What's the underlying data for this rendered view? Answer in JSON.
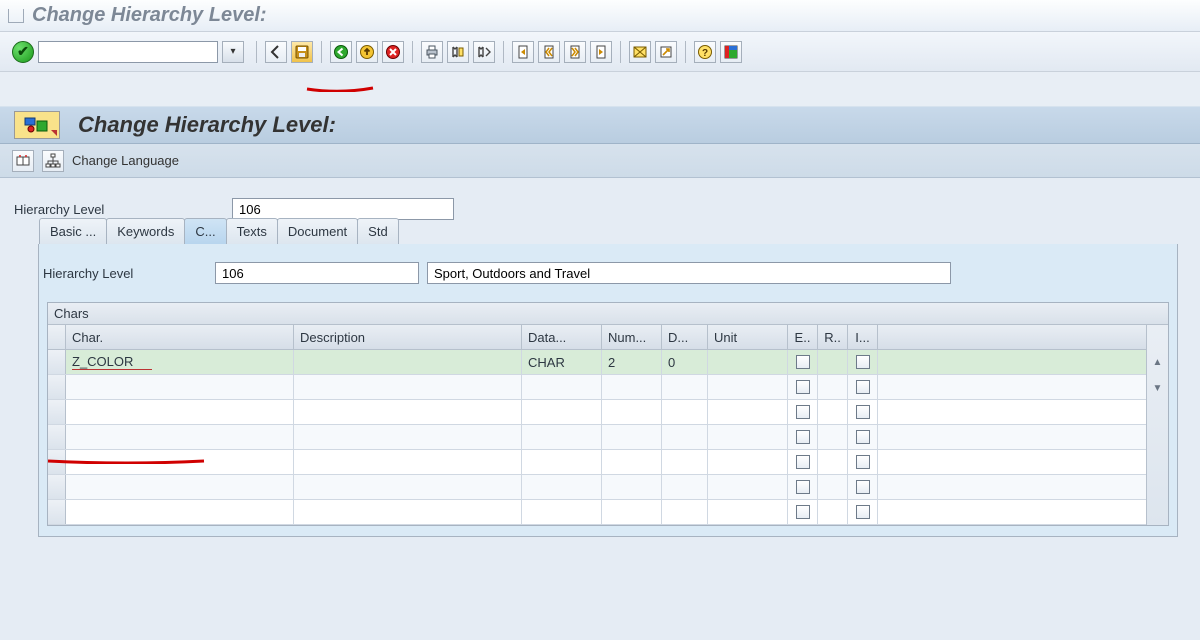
{
  "window": {
    "title": "Change Hierarchy Level:"
  },
  "toolbar": {
    "icons": [
      "ok",
      "cmd",
      "dropdown",
      "sep",
      "back",
      "save",
      "sep",
      "nav-back",
      "nav-up",
      "cancel",
      "sep",
      "print",
      "find",
      "find-next",
      "sep",
      "first",
      "prev",
      "next",
      "last",
      "sep",
      "new-window",
      "link",
      "sep",
      "help",
      "layout"
    ]
  },
  "page": {
    "title": "Change Hierarchy Level:",
    "change_language_label": "Change Language",
    "hierarchy_level_label": "Hierarchy Level",
    "hierarchy_level_value": "106"
  },
  "tabs": {
    "items": [
      {
        "label": "Basic ..."
      },
      {
        "label": "Keywords"
      },
      {
        "label": "C..."
      },
      {
        "label": "Texts"
      },
      {
        "label": "Document"
      },
      {
        "label": "Std"
      }
    ],
    "active_index": 2
  },
  "subform": {
    "hierarchy_level_label": "Hierarchy Level",
    "hierarchy_level_value": "106",
    "description_value": "Sport, Outdoors and Travel"
  },
  "table": {
    "title": "Chars",
    "columns": {
      "char": "Char.",
      "description": "Description",
      "data": "Data...",
      "num": "Num...",
      "d": "D...",
      "unit": "Unit",
      "e": "E..",
      "r": "R..",
      "i": "I..."
    },
    "rows": [
      {
        "char": "Z_COLOR",
        "description": "",
        "data": "CHAR",
        "num": "2",
        "d": "0",
        "unit": "",
        "e": false,
        "r": false,
        "i": false
      },
      {
        "char": "",
        "description": "",
        "data": "",
        "num": "",
        "d": "",
        "unit": "",
        "e": false,
        "r": false,
        "i": false
      },
      {
        "char": "",
        "description": "",
        "data": "",
        "num": "",
        "d": "",
        "unit": "",
        "e": false,
        "r": false,
        "i": false
      },
      {
        "char": "",
        "description": "",
        "data": "",
        "num": "",
        "d": "",
        "unit": "",
        "e": false,
        "r": false,
        "i": false
      },
      {
        "char": "",
        "description": "",
        "data": "",
        "num": "",
        "d": "",
        "unit": "",
        "e": false,
        "r": false,
        "i": false
      },
      {
        "char": "",
        "description": "",
        "data": "",
        "num": "",
        "d": "",
        "unit": "",
        "e": false,
        "r": false,
        "i": false
      },
      {
        "char": "",
        "description": "",
        "data": "",
        "num": "",
        "d": "",
        "unit": "",
        "e": false,
        "r": false,
        "i": false
      }
    ]
  }
}
